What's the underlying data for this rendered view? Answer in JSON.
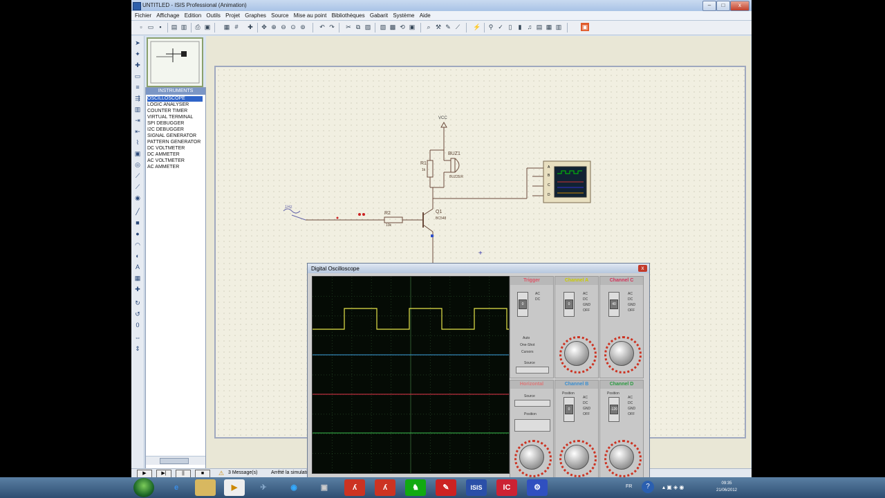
{
  "window": {
    "title": "UNTITLED - ISIS Professional (Animation)"
  },
  "menu": [
    "Fichier",
    "Affichage",
    "Edition",
    "Outils",
    "Projet",
    "Graphes",
    "Source",
    "Mise au point",
    "Bibliothèques",
    "Gabarit",
    "Système",
    "Aide"
  ],
  "panel": {
    "header": "INSTRUMENTS",
    "items": [
      "OSCILLOSCOPE",
      "LOGIC ANALYSER",
      "COUNTER TIMER",
      "VIRTUAL TERMINAL",
      "SPI DEBUGGER",
      "I2C DEBUGGER",
      "SIGNAL GENERATOR",
      "PATTERN GENERATOR",
      "DC VOLTMETER",
      "DC AMMETER",
      "AC VOLTMETER",
      "AC AMMETER"
    ],
    "selected_index": 0
  },
  "schematic": {
    "vcc_label": "VCC",
    "r1": {
      "ref": "R1",
      "value": "1k"
    },
    "buz": {
      "ref": "BUZ1",
      "value": "BUZZER"
    },
    "r2": {
      "ref": "R2",
      "value": "10k"
    },
    "q1": {
      "ref": "Q1",
      "value": "BC548"
    },
    "generator_label": "1Hz",
    "osc_pins": [
      "A",
      "B",
      "C",
      "D"
    ]
  },
  "statusbar": {
    "messages": "3 Message(s)",
    "status_text": "Arrêté la simulation"
  },
  "oscilloscope": {
    "title": "Digital Oscilloscope",
    "channel_a": "Channel A",
    "channel_b": "Channel B",
    "channel_c": "Channel C",
    "channel_d": "Channel D",
    "trigger": "Trigger",
    "horizontal": "Horizontal",
    "coupling": [
      "AC",
      "DC",
      "GND",
      "OFF"
    ],
    "trigger_modes": [
      "Auto",
      "One-Shot",
      "Cursors"
    ],
    "source": "Source",
    "position": "Position",
    "colors": {
      "a": "#e6e64a",
      "b": "#3aa0e0",
      "c": "#e8344a",
      "d": "#3ac050"
    }
  },
  "tray": {
    "lang": "FR",
    "time": "09:35",
    "date": "21/06/2012"
  }
}
